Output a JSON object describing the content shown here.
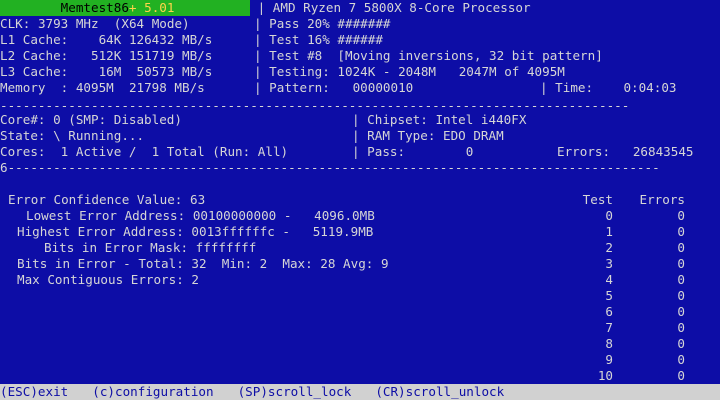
{
  "header": {
    "app_name": "Memtest86",
    "app_plus": "+",
    "version": "5.01",
    "cpu": "AMD Ryzen 7 5800X 8-Core Processor"
  },
  "system": {
    "clk_label": "CLK:",
    "clk_value": "3793 MHz",
    "clk_mode": "(X64 Mode)",
    "l1_label": "L1 Cache:",
    "l1_size": "64K",
    "l1_speed": "126432 MB/s",
    "l2_label": "L2 Cache:",
    "l2_size": "512K",
    "l2_speed": "151719 MB/s",
    "l3_label": "L3 Cache:",
    "l3_size": "16M",
    "l3_speed": "50573 MB/s",
    "mem_label": "Memory  :",
    "mem_size": "4095M",
    "mem_speed": "21798 MB/s"
  },
  "progress": {
    "pass_text": "Pass 20% #######",
    "test_text": "Test 16% ######",
    "test_num_text": "Test #8  [Moving inversions, 32 bit pattern]",
    "testing_text": "Testing: 1024K - 2048M   2047M of 4095M",
    "pattern_label": "Pattern:",
    "pattern_value": "00000010",
    "time_label": "Time:",
    "time_value": "0:04:03"
  },
  "status": {
    "core_text": "Core#: 0 (SMP: Disabled)",
    "state_text": "State: \\ Running...",
    "cores_text": "Cores:  1 Active /  1 Total (Run: All)",
    "chipset_label": "Chipset:",
    "chipset_value": "Intel i440FX",
    "ramtype_label": "RAM Type:",
    "ramtype_value": "EDO DRAM",
    "pass_label": "Pass:",
    "pass_value": "0",
    "errors_label": "Errors:",
    "errors_value": "26843545"
  },
  "separator_prefix": "6",
  "errors_detail": {
    "confidence_label": "Error Confidence Value:",
    "confidence_value": "63",
    "lowest_label": "Lowest Error Address:",
    "lowest_value": "00100000000 -   4096.0MB",
    "highest_label": "Highest Error Address:",
    "highest_value": "0013ffffffc -   5119.9MB",
    "mask_label": "Bits in Error Mask:",
    "mask_value": "ffffffff",
    "total_label": "Bits in Error - Total:",
    "total_value": "32  Min: 2  Max: 28 Avg: 9",
    "contig_label": "Max Contiguous Errors:",
    "contig_value": "2"
  },
  "test_table": {
    "header_test": "Test",
    "header_errors": "Errors",
    "rows": [
      {
        "test": "0",
        "errors": "0"
      },
      {
        "test": "1",
        "errors": "0"
      },
      {
        "test": "2",
        "errors": "0"
      },
      {
        "test": "3",
        "errors": "0"
      },
      {
        "test": "4",
        "errors": "0"
      },
      {
        "test": "5",
        "errors": "0"
      },
      {
        "test": "6",
        "errors": "0"
      },
      {
        "test": "7",
        "errors": "0"
      },
      {
        "test": "8",
        "errors": "0"
      },
      {
        "test": "9",
        "errors": "0"
      },
      {
        "test": "10",
        "errors": "0"
      }
    ]
  },
  "bottom_bar": {
    "exit": "(ESC)exit",
    "config": "(c)configuration",
    "scroll_lock": "(SP)scroll_lock",
    "scroll_unlock": "(CR)scroll_unlock"
  }
}
